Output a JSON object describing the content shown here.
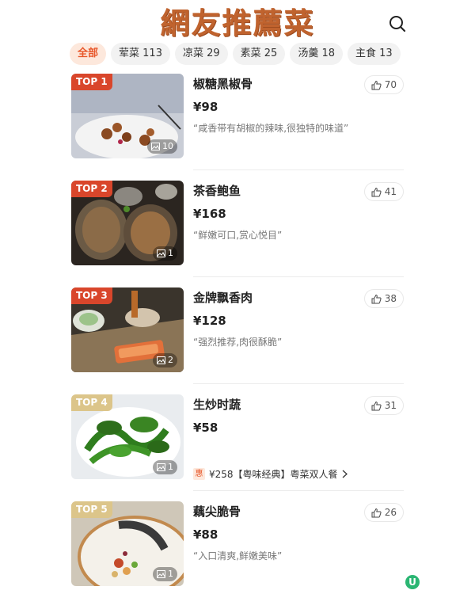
{
  "header": {
    "title": "網友推薦菜",
    "search_icon": "search-icon"
  },
  "tabs": [
    {
      "label": "全部",
      "active": true
    },
    {
      "label": "荤菜 113"
    },
    {
      "label": "凉菜 29"
    },
    {
      "label": "素菜 25"
    },
    {
      "label": "汤羹 18"
    },
    {
      "label": "主食 13"
    }
  ],
  "dishes": [
    {
      "rank": "TOP 1",
      "name": "椒糖黑椒骨",
      "price": "¥98",
      "quote": "“咸香带有胡椒的辣味,很独特的味道”",
      "likes": "70",
      "photos": "10"
    },
    {
      "rank": "TOP 2",
      "name": "茶香鲍鱼",
      "price": "¥168",
      "quote": "“鲜嫩可口,赏心悦目”",
      "likes": "41",
      "photos": "1"
    },
    {
      "rank": "TOP 3",
      "name": "金牌飘香肉",
      "price": "¥128",
      "quote": "“强烈推荐,肉很酥脆”",
      "likes": "38",
      "photos": "2"
    },
    {
      "rank": "TOP 4",
      "name": "生炒时蔬",
      "price": "¥58",
      "likes": "31",
      "photos": "1",
      "deal": {
        "tag": "惠",
        "text": "¥258【粤味经典】粤菜双人餐"
      }
    },
    {
      "rank": "TOP 5",
      "name": "藕尖脆骨",
      "price": "¥88",
      "quote": "“入口清爽,鲜嫩美味”",
      "likes": "26",
      "photos": "1"
    }
  ],
  "colors": {
    "accent": "#e8572a",
    "title": "#c0632e",
    "rank_hot": "#d9462b",
    "rank_warm": "#dcc58a"
  }
}
